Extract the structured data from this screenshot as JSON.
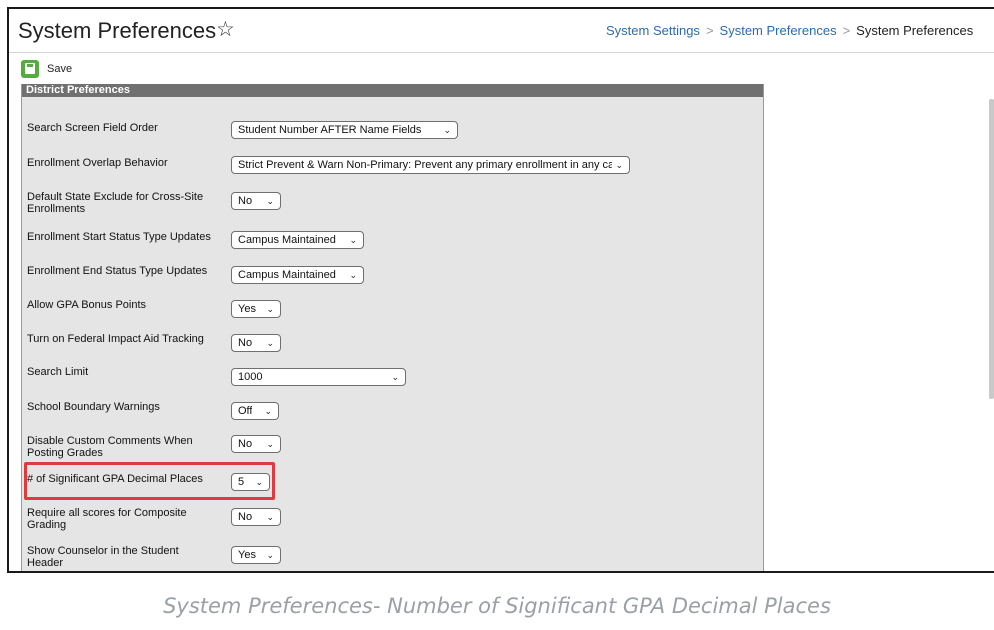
{
  "header": {
    "title": "System Preferences",
    "star_icon": "star-outline-icon",
    "breadcrumb": [
      "System Settings",
      "System Preferences",
      "System Preferences"
    ]
  },
  "toolbar": {
    "save_label": "Save",
    "save_icon": "save-icon",
    "save_color": "#56ab3e"
  },
  "panel": {
    "title": "District Preferences",
    "rows": [
      {
        "label": "Search Screen Field Order",
        "value": "Student Number AFTER Name Fields"
      },
      {
        "label": "Enrollment Overlap Behavior",
        "value": "Strict Prevent & Warn Non-Primary: Prevent any primary enrollment in any ca"
      },
      {
        "label": "Default State Exclude for Cross-Site Enrollments",
        "value": "No"
      },
      {
        "label": "Enrollment Start Status Type Updates",
        "value": "Campus Maintained"
      },
      {
        "label": "Enrollment End Status Type Updates",
        "value": "Campus Maintained"
      },
      {
        "label": "Allow GPA Bonus Points",
        "value": "Yes"
      },
      {
        "label": "Turn on Federal Impact Aid Tracking",
        "value": "No"
      },
      {
        "label": "Search Limit",
        "value": "1000"
      },
      {
        "label": "School Boundary Warnings",
        "value": "Off"
      },
      {
        "label": "Disable Custom Comments When Posting Grades",
        "value": "No"
      },
      {
        "label": "# of Significant GPA Decimal Places",
        "value": "5"
      },
      {
        "label": "Require all scores for Composite Grading",
        "value": "No"
      },
      {
        "label": "Show Counselor in the Student Header",
        "value": "Yes"
      }
    ]
  },
  "highlight_color": "#e0393e",
  "caption": "System Preferences- Number of Significant GPA Decimal Places"
}
